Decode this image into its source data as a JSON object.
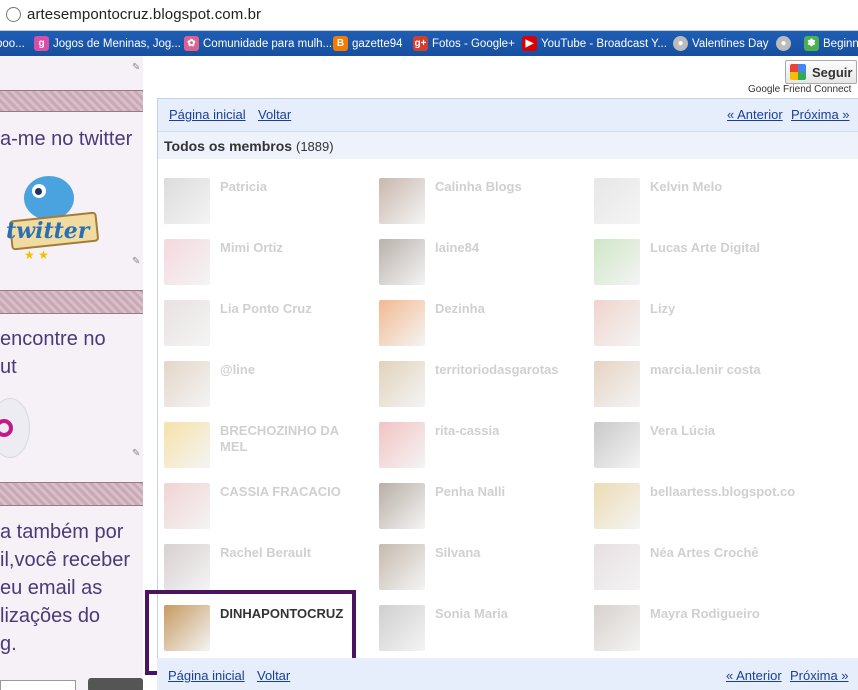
{
  "browser": {
    "url": "artesempontocruz.blogspot.com.br",
    "bookmarks": [
      {
        "label": "boo...",
        "icon": "book-icon",
        "color": "#3a6cc0"
      },
      {
        "label": "Jogos de Meninas, Jog...",
        "icon": "game-icon",
        "color": "#d94ea6"
      },
      {
        "label": "Comunidade para mulh...",
        "icon": "community-icon",
        "color": "#e06090"
      },
      {
        "label": "gazette94",
        "icon": "blogger-icon",
        "color": "#f57c00"
      },
      {
        "label": "Fotos - Google+",
        "icon": "google-plus-icon",
        "color": "#d23f31"
      },
      {
        "label": "YouTube - Broadcast Y...",
        "icon": "youtube-icon",
        "color": "#d00"
      },
      {
        "label": "Valentines Day",
        "icon": "globe-icon",
        "color": "#bbb"
      },
      {
        "label": "",
        "icon": "globe-icon",
        "color": "#bbb"
      },
      {
        "label": "Beginn",
        "icon": "leaf-icon",
        "color": "#4caf50"
      }
    ]
  },
  "sidebar": {
    "twitter_heading": "a-me no twitter",
    "twitter_badge": "twitter",
    "orkut_line1": "encontre no",
    "orkut_line2": "ut",
    "email_line1": "a também por",
    "email_line2": "il,você receber",
    "email_line3": "eu email as",
    "email_line4": "lizações do",
    "email_line5": "g."
  },
  "gfc": {
    "follow_label": "Seguir",
    "caption": "Google Friend Connect"
  },
  "nav": {
    "home": "Página inicial",
    "back": "Voltar",
    "prev": "« Anterior",
    "next": "Próxima »"
  },
  "members_header": {
    "title": "Todos os membros",
    "count": "(1889)"
  },
  "members": [
    {
      "name": "Patricia",
      "color": "#dcdcdc"
    },
    {
      "name": "Calinha Blogs",
      "color": "#c9b8ad"
    },
    {
      "name": "Kelvin Melo",
      "color": "#e7e7e7"
    },
    {
      "name": "Mimi Ortiz",
      "color": "#f5d8de"
    },
    {
      "name": "laine84",
      "color": "#b9b1ab"
    },
    {
      "name": "Lucas Arte Digital",
      "color": "#cfe6c6"
    },
    {
      "name": "Lia Ponto Cruz",
      "color": "#e9e2e2"
    },
    {
      "name": "Dezinha",
      "color": "#f3b990"
    },
    {
      "name": "Lizy",
      "color": "#f0d4cd"
    },
    {
      "name": "@line",
      "color": "#e4d6c8"
    },
    {
      "name": "territoriodasgarotas",
      "color": "#e1d2bb"
    },
    {
      "name": "marcia.lenir costa",
      "color": "#e6d3c3"
    },
    {
      "name": "BRECHOZINHO DA MEL",
      "color": "#f6e2a8"
    },
    {
      "name": "rita-cassia",
      "color": "#f3c3c3"
    },
    {
      "name": "Vera Lúcia",
      "color": "#c9c9c9"
    },
    {
      "name": "CASSIA FRACACIO",
      "color": "#f1d3d3"
    },
    {
      "name": "Penha Nalli",
      "color": "#b8aea6"
    },
    {
      "name": "bellaartess.blogspot.co",
      "color": "#ecdcb2"
    },
    {
      "name": "Rachel Berault",
      "color": "#d8d0d0"
    },
    {
      "name": "Silvana",
      "color": "#c6b9ad"
    },
    {
      "name": "Néa Artes Crochê",
      "color": "#e7dfe2"
    },
    {
      "name": "DINHAPONTOCRUZ",
      "color": "#c79a62"
    },
    {
      "name": "Sonia Maria",
      "color": "#cfcfcf"
    },
    {
      "name": "Mayra Rodigueiro",
      "color": "#d7d1cd"
    }
  ]
}
